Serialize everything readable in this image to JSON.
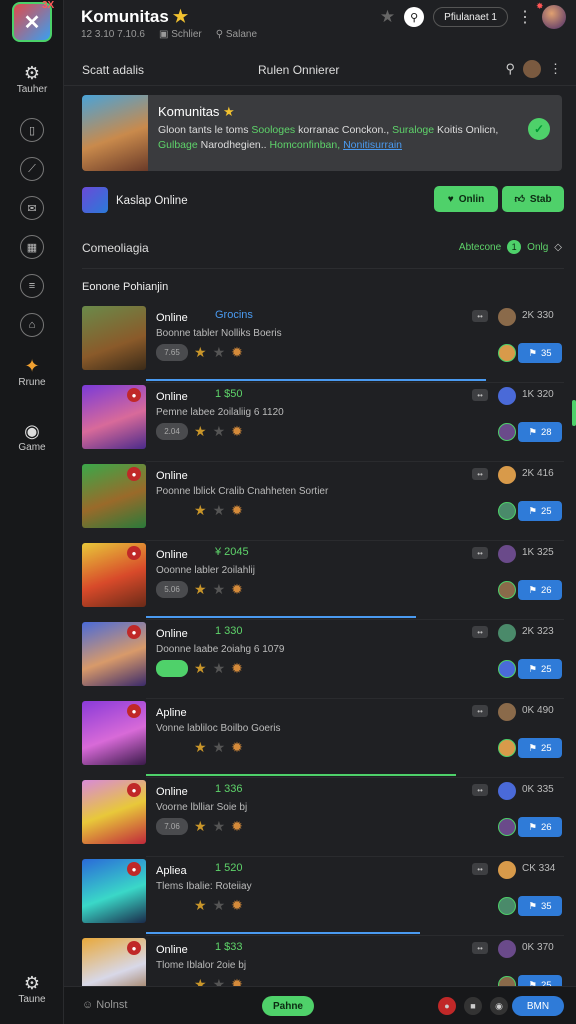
{
  "app": {
    "title": "Komunitas",
    "subline_1": "12 3.10  7.10.6",
    "subline_2": "Schlier",
    "subline_3": "Salane",
    "header_pill": "Pfiulanaet 1",
    "logo_badge": "3X"
  },
  "sidebar": {
    "items": [
      {
        "label": "Tauher",
        "icon": "gear-icon"
      },
      {
        "label": "",
        "icon": "shield-icon"
      },
      {
        "label": "",
        "icon": "chart-icon"
      },
      {
        "label": "",
        "icon": "mail-icon"
      },
      {
        "label": "",
        "icon": "calendar-icon"
      },
      {
        "label": "",
        "icon": "list-icon"
      },
      {
        "label": "",
        "icon": "bell-icon"
      },
      {
        "label": "Rrune",
        "icon": "fire-icon"
      },
      {
        "label": "Game",
        "icon": "gamepad-icon"
      }
    ],
    "bottom_label": "Taune"
  },
  "subheader": {
    "left": "Scatt adalis",
    "middle": "Rulen Onnierer"
  },
  "banner": {
    "title": "Komunitas",
    "text_plain_1": "Gloon tants le toms ",
    "text_green_1": "Soologes",
    "text_plain_2": " korranac Conckon.,",
    "text_green_2": " Suraloge",
    "text_plain_3": " Koitis Onlicn, ",
    "text_green_3": "Gulbage",
    "text_plain_4": " Narodhegien.. ",
    "text_green_4": "Homconfinban,",
    "text_link": "Nonitisurrain"
  },
  "status": {
    "text": "Kaslap Online",
    "btn_1": "Onlin",
    "btn_2": "Stab"
  },
  "section": {
    "title": "Comeoliagia",
    "right_label": "Abtecone",
    "right_count": "1",
    "right_label_2": "Onlg"
  },
  "list": {
    "title": "Eonone Pohianjin",
    "rows": [
      {
        "name": "Online",
        "tag": "Grocins",
        "tag_color": "#4a9af0",
        "desc": "Boonne tabler Nolliks Boeris",
        "pill": "7.65",
        "meta": "2K  330",
        "btn": "35",
        "bar_width": 340,
        "bar_color": "#4a9af0",
        "thumb": "linear-gradient(160deg,#6a8a4a,#8a5a2a 60%,#3a2a18)"
      },
      {
        "name": "Online",
        "tag": "1 $50",
        "tag_color": "#5ed36a",
        "desc": "Pemne labee 2oilaliig  6 1120",
        "pill": "2.04",
        "meta": "1K  320",
        "btn": "28",
        "bar_width": 0,
        "bar_color": "#4ed16a",
        "thumb": "linear-gradient(160deg,#7a3ad8,#d86a9a 55%,#4a2a8a)"
      },
      {
        "name": "Online",
        "tag": "",
        "tag_color": "#5ed36a",
        "desc": "Poonne lblick Cralib Cnahheten Sortier",
        "pill": "",
        "meta": "2K  416",
        "btn": "25",
        "bar_width": 0,
        "bar_color": "#4ed16a",
        "thumb": "linear-gradient(160deg,#3aa84a,#9a6a2a 55%,#2a7a3a)"
      },
      {
        "name": "Online",
        "tag": "¥ 2045",
        "tag_color": "#5ed36a",
        "desc": "Ooonne labler 2oilahlij",
        "pill": "5.06",
        "meta": "1K  325",
        "btn": "26",
        "bar_width": 270,
        "bar_color": "#4a9af0",
        "thumb": "linear-gradient(160deg,#e8c83a,#d84a2a 55%,#6a2a18)"
      },
      {
        "name": "Online",
        "tag": "1 330",
        "tag_color": "#5ed36a",
        "desc": "Doonne laabe 2oiahg  6 1079",
        "pill": "green",
        "meta": "2K  323",
        "btn": "25",
        "bar_width": 0,
        "bar_color": "#4ed16a",
        "thumb": "linear-gradient(160deg,#4a6ad8,#d89a6a 55%,#3a2a6a)"
      },
      {
        "name": "Apline",
        "tag": "",
        "tag_color": "#5ed36a",
        "desc": "Vonne labliloc Boilbo Goeris",
        "pill": "",
        "meta": "0K  490",
        "btn": "25",
        "bar_width": 310,
        "bar_color": "#4ed16a",
        "thumb": "linear-gradient(160deg,#8a3ad8,#d86ad8 55%,#3a1a4a)"
      },
      {
        "name": "Online",
        "tag": "1 336",
        "tag_color": "#5ed36a",
        "desc": "Voorne lblliar Soie bj",
        "pill": "7.06",
        "meta": "0K  335",
        "btn": "26",
        "bar_width": 0,
        "bar_color": "#4ed16a",
        "thumb": "linear-gradient(160deg,#d88ad8,#e8c83a 50%,#c0283a)"
      },
      {
        "name": "Apliea",
        "tag": "1 520",
        "tag_color": "#5ed36a",
        "desc": "Tlems Ibalie: Roteiiay",
        "pill": "",
        "meta": "CK  334",
        "btn": "35",
        "bar_width": 274,
        "bar_color": "#4a9af0",
        "thumb": "linear-gradient(160deg,#2a6ad8,#3ad8c8 55%,#1a2a4a)"
      },
      {
        "name": "Online",
        "tag": "1 $33",
        "tag_color": "#5ed36a",
        "desc": "Tlome Iblalor 2oie bj",
        "pill": "",
        "meta": "0K  370",
        "btn": "25",
        "bar_width": 0,
        "bar_color": "#4ed16a",
        "thumb": "linear-gradient(160deg,#e8a83a,#d8d8e8 55%,#8a5a2a)"
      }
    ]
  },
  "bottom": {
    "left": "Nolnst",
    "center": "Pahne",
    "right": "BMN"
  },
  "colors": {
    "accent_green": "#4fd16a",
    "accent_blue": "#2f7bd8",
    "background": "#1f2023"
  }
}
